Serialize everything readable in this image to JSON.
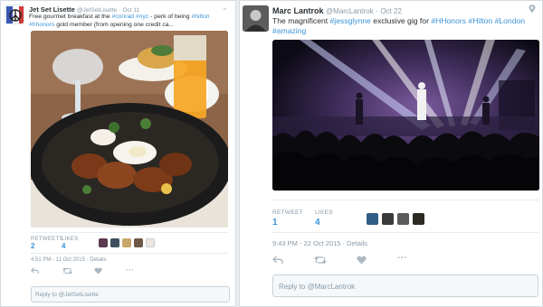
{
  "tweet1": {
    "name": "Jet Set Lisette",
    "handle": "@JetSetLisette",
    "date": "Oct 11",
    "text_parts": [
      "Free gourmet breakfast at the ",
      "#conrad",
      " ",
      "#nyc",
      " - perk of being ",
      "#hilton",
      " ",
      "#hhonors",
      " gold member (from opening one credit ca..."
    ],
    "retweets_label": "RETWEETS",
    "retweets": "2",
    "likes_label": "LIKES",
    "likes": "4",
    "timestamp": "4:51 PM - 11 Oct 2015 · Details",
    "reply_placeholder": "Reply to @JetSetLisette"
  },
  "tweet2": {
    "name": "Marc Lantrok",
    "handle": "@MarcLantrok",
    "date": "Oct 22",
    "text_parts": [
      "The magnificent ",
      "#jessglynne",
      " exclusive  gig for ",
      "#HHonors",
      " ",
      "#Hilton",
      " ",
      "#London",
      " ",
      "#amazing"
    ],
    "retweets_label": "RETWEET",
    "retweets": "1",
    "likes_label": "LIKES",
    "likes": "4",
    "timestamp": "9:43 PM - 22 Oct 2015 · Details",
    "reply_placeholder": "Reply to @MarcLantrok"
  },
  "icons": {
    "reply": "reply-icon",
    "retweet": "retweet-icon",
    "like": "heart-icon",
    "more": "more-icon",
    "location": "location-icon",
    "chevron": "chevron-down-icon"
  },
  "colors": {
    "link": "#3b94d9",
    "muted": "#8899a6",
    "text": "#292f33",
    "border": "#d6dbdf"
  }
}
